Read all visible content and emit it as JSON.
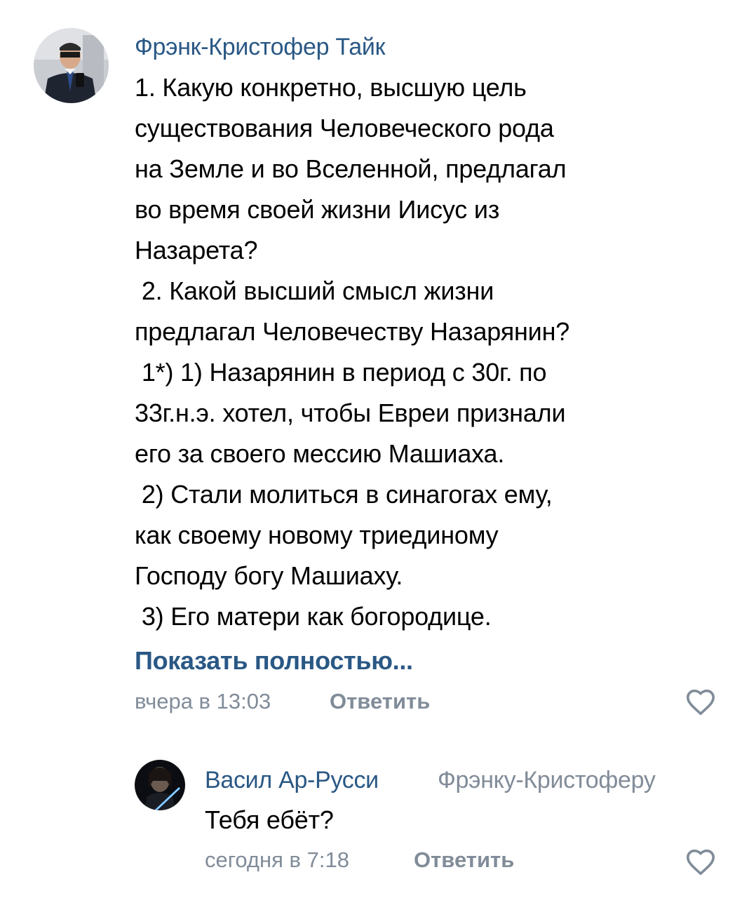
{
  "comments": [
    {
      "author": "Фрэнк-Кристофер Тайк",
      "text": "1. Какую конкретно, высшую цель\nсуществования Человеческого рода\nна Земле и во Вселенной, предлагал\nво время своей жизни Иисус из\nНазарета?\n 2. Какой высший смысл жизни\nпредлагал Человечеству Назарянин?\n 1*) 1) Назарянин в период с 30г. по\n33г.н.э. хотел, чтобы Евреи признали\nего за своего мессию Машиаха.\n 2) Стали молиться в синагогах ему,\nкак своему новому триединому\nГосподу богу Машиаху.\n 3) Его матери как богородице.",
      "show_more": "Показать полностью...",
      "time": "вчера в 13:03",
      "reply_label": "Ответить"
    },
    {
      "author": "Васил Ар-Русси",
      "reply_to": "Фрэнку-Кристоферу",
      "text": "Тебя ебёт?",
      "time": "сегодня в 7:18",
      "reply_label": "Ответить"
    }
  ],
  "icons": {
    "like": "heart-outline-icon"
  },
  "colors": {
    "link": "#2a5885",
    "secondary": "#818c99",
    "text": "#000000",
    "background": "#ffffff"
  }
}
